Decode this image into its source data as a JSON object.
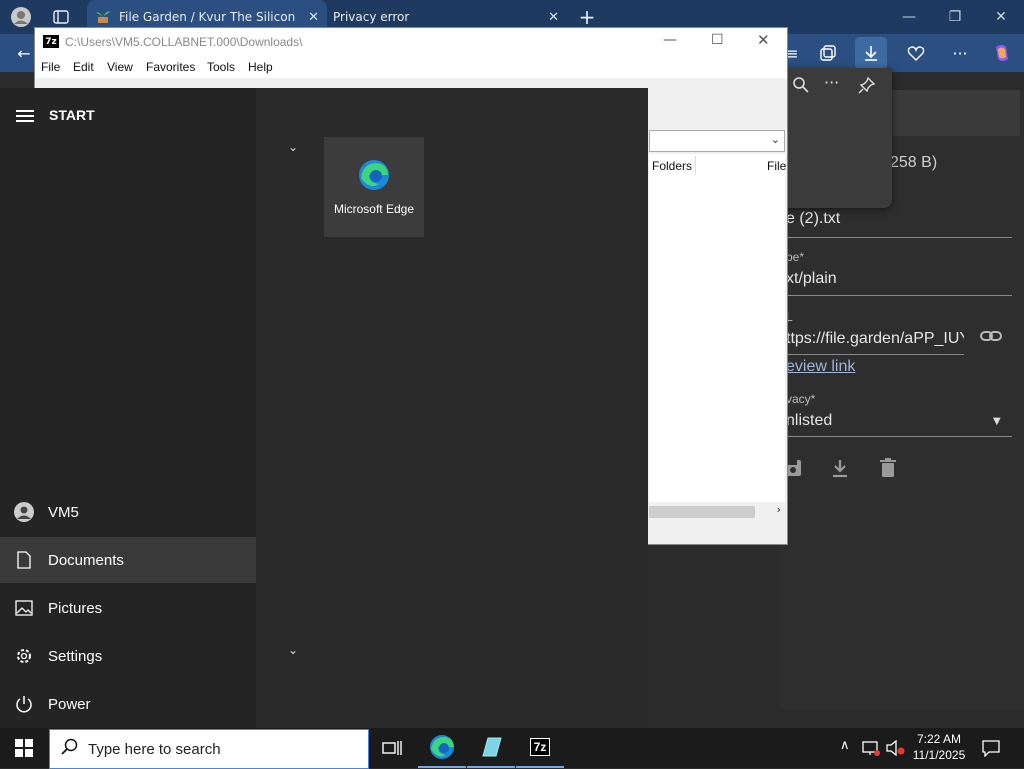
{
  "browser": {
    "tabs": [
      {
        "title": "File Garden / Kvur The Silicon",
        "close": "✕"
      },
      {
        "title": "Privacy error",
        "close": "✕"
      }
    ],
    "new_tab": "+",
    "win_min": "—",
    "win_restore": "❐",
    "win_close": "✕"
  },
  "page": {
    "size_suffix": "258 B)",
    "filename_partial": "e (2).txt",
    "type_label": "pe*",
    "type_value": "xt/plain",
    "url_label": "L",
    "url_value": "ttps://file.garden/aPP_IUY",
    "preview_link": "eview link",
    "privacy_label": "vacy*",
    "privacy_value": "nlisted"
  },
  "zip": {
    "path": "C:\\Users\\VM5.COLLABNET.000\\Downloads\\",
    "app_badge": "7z",
    "menu": [
      "File",
      "Edit",
      "View",
      "Favorites",
      "Tools",
      "Help"
    ],
    "col_folders": "Folders",
    "col_file": "File"
  },
  "start": {
    "header": "START",
    "user": "VM5",
    "items": [
      "Documents",
      "Pictures",
      "Settings",
      "Power"
    ],
    "tile": "Microsoft Edge"
  },
  "taskbar": {
    "search_placeholder": "Type here to search",
    "time": "7:22 AM",
    "date": "11/1/2025",
    "zip_badge": "7z"
  }
}
